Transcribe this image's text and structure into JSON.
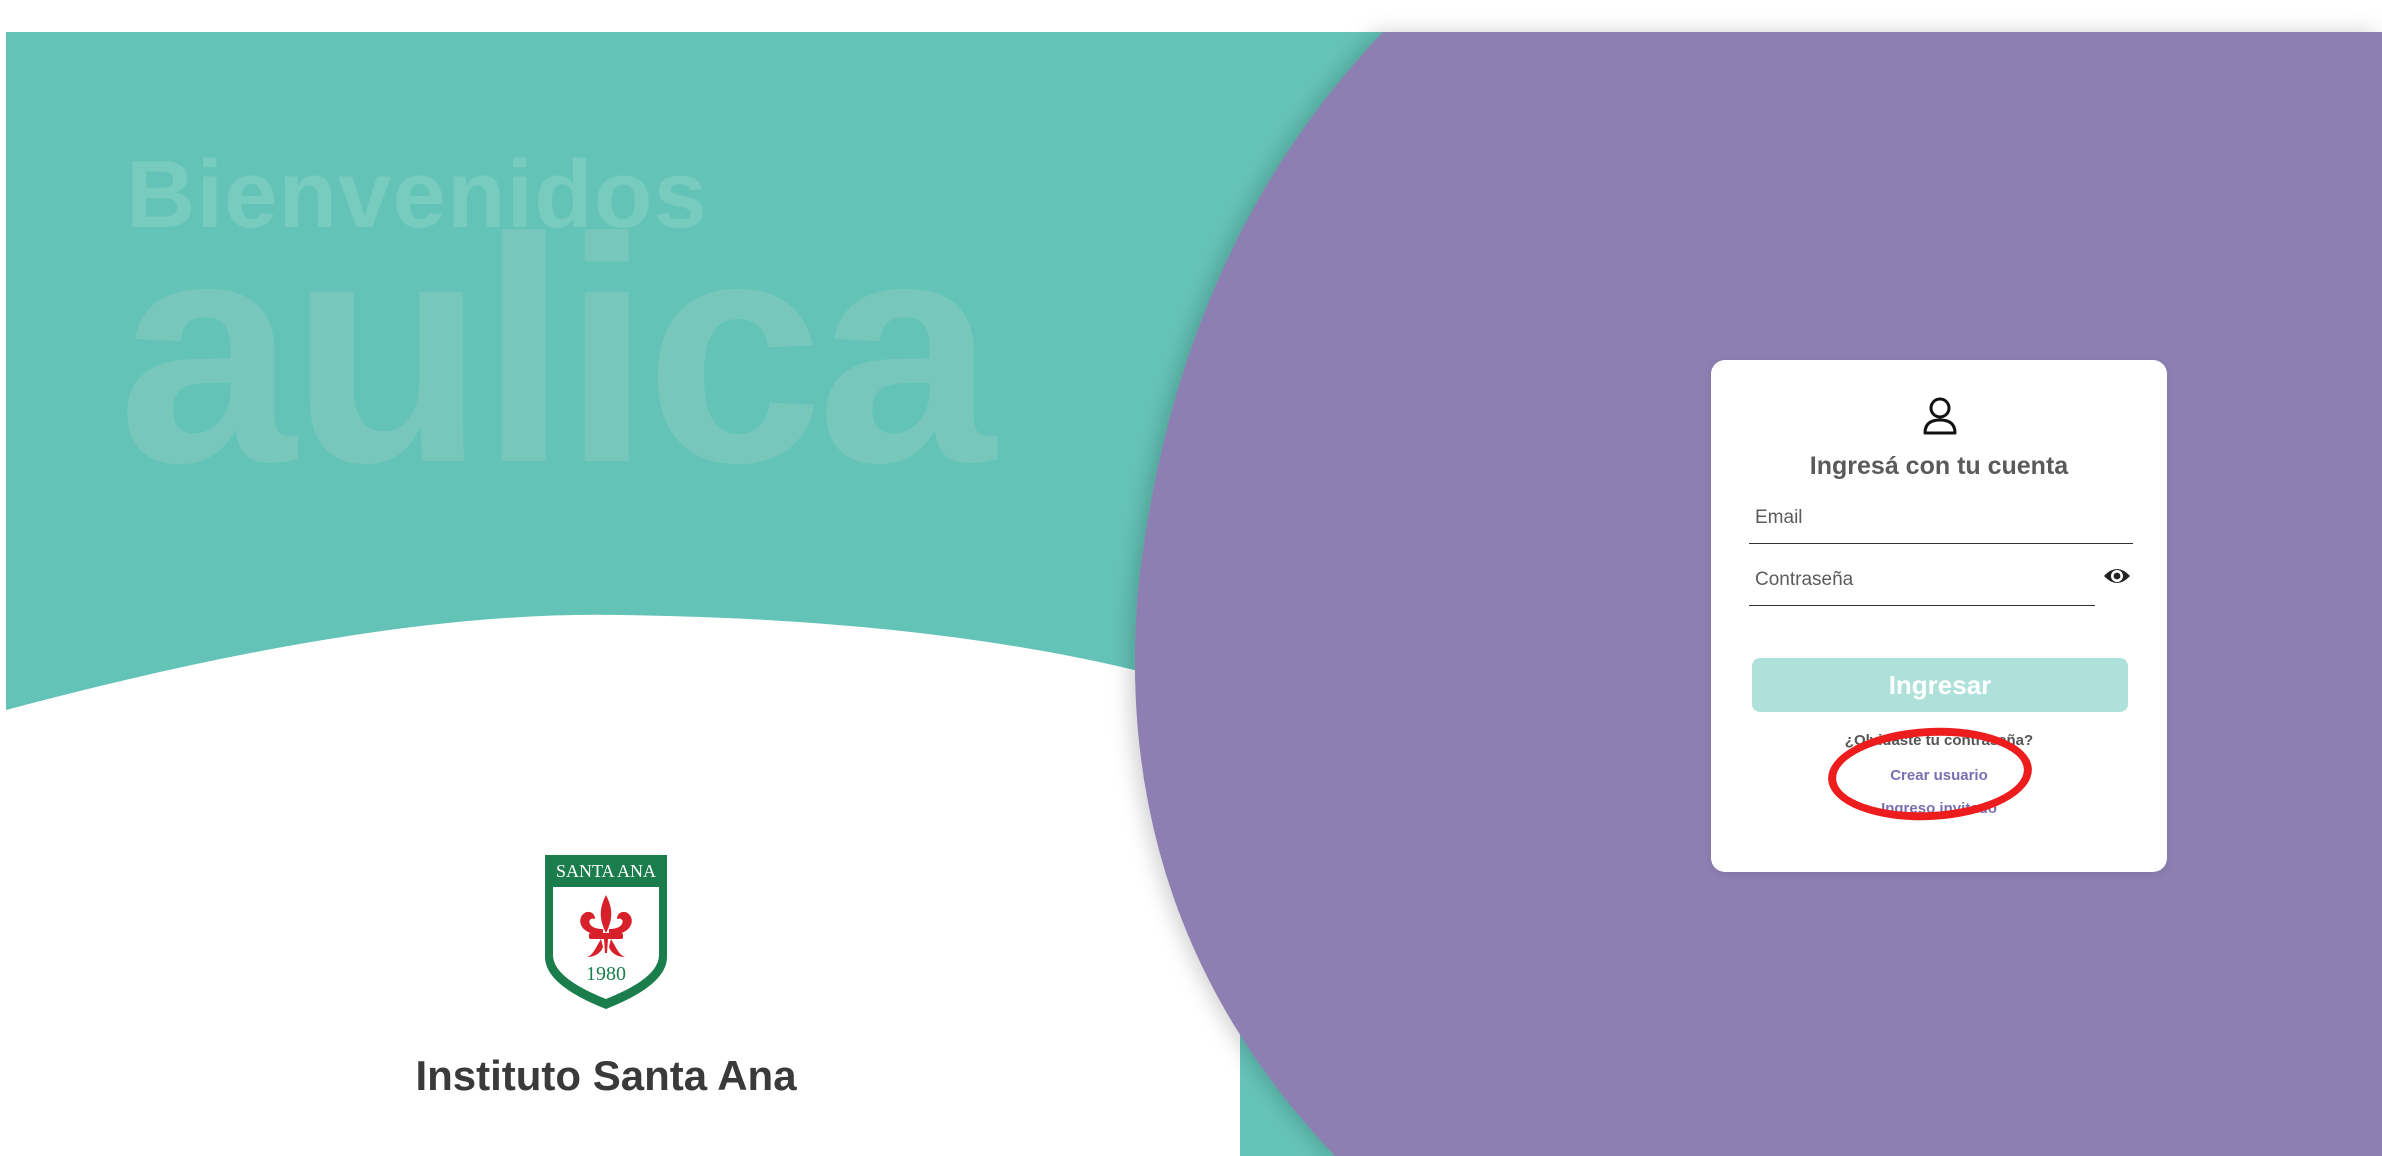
{
  "colors": {
    "teal": "#64c3b7",
    "purple": "#8d7fb2",
    "white": "#ffffff",
    "button_disabled": "#aee1da",
    "link_purple": "#7d6eb2",
    "annotation_red": "#ee1d1d",
    "crest_green": "#1b7d4b",
    "crest_red": "#d8202a"
  },
  "watermark": {
    "welcome": "Bienvenidos",
    "brand": "aulica"
  },
  "school": {
    "crest_top": "SANTA ANA",
    "crest_year": "1980",
    "name": "Instituto Santa Ana"
  },
  "login": {
    "icon": "user-icon",
    "title": "Ingresá con tu cuenta",
    "email_placeholder": "Email",
    "email_value": "",
    "password_placeholder": "Contraseña",
    "password_value": "",
    "password_toggle_icon": "eye-icon",
    "submit_label": "Ingresar",
    "forgot_password": "¿Olvidaste tu contraseña?",
    "create_user": "Crear usuario",
    "third_link": "Ingreso invitado"
  },
  "annotation": {
    "shape": "ellipse",
    "target": "create-user-link"
  }
}
